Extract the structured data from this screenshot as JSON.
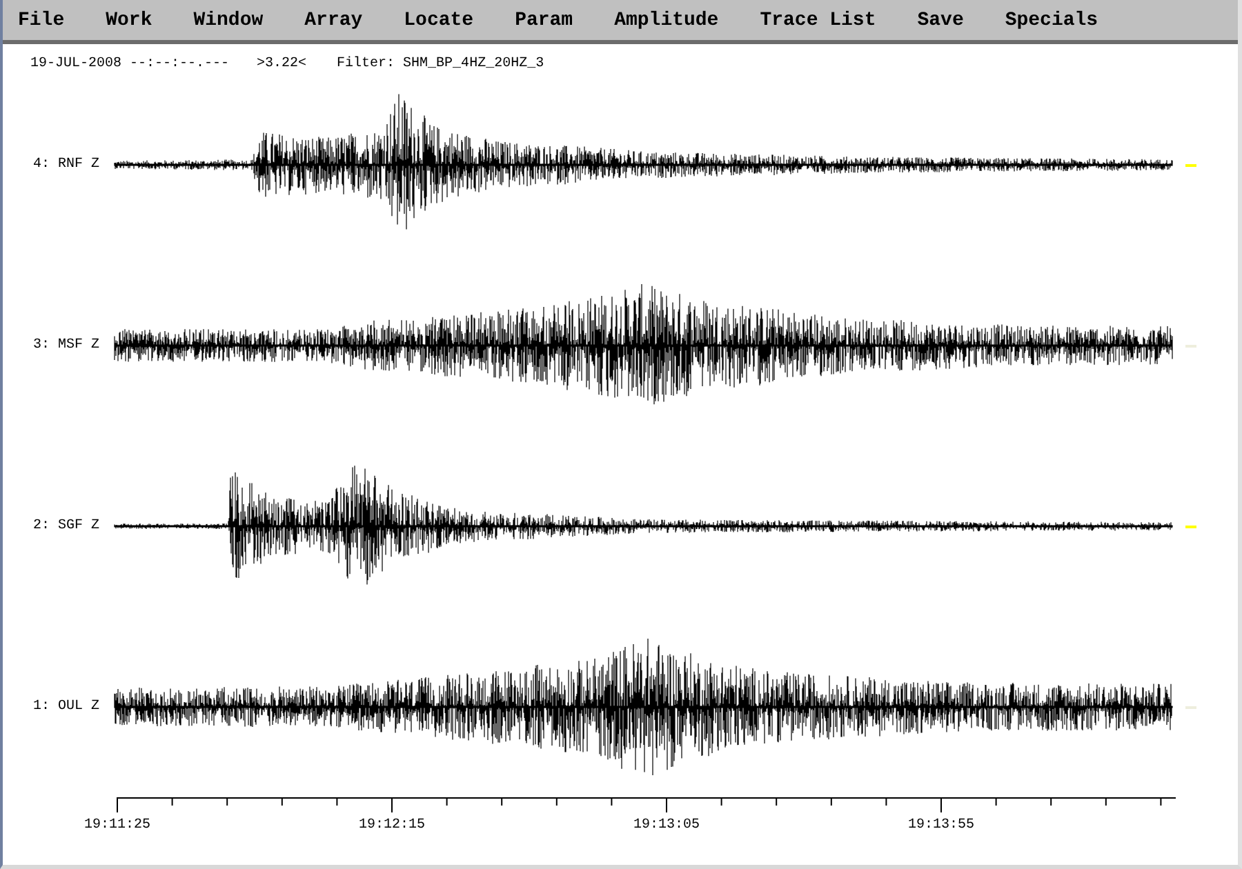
{
  "menu": [
    {
      "label": "File"
    },
    {
      "label": "Work"
    },
    {
      "label": "Window"
    },
    {
      "label": "Array"
    },
    {
      "label": "Locate"
    },
    {
      "label": "Param"
    },
    {
      "label": "Amplitude"
    },
    {
      "label": "Trace List"
    },
    {
      "label": "Save"
    },
    {
      "label": "Specials"
    }
  ],
  "header": {
    "date_time": "19-JUL-2008 --:--:--.---",
    "amplitude": ">3.22<",
    "filter": "Filter: SHM_BP_4HZ_20HZ_3"
  },
  "traces": [
    {
      "label": "4: RNF Z",
      "color": "#ffff00"
    },
    {
      "label": "3: MSF Z",
      "color": "#eeeedd"
    },
    {
      "label": "2: SGF Z",
      "color": "#ffff00"
    },
    {
      "label": "1: OUL Z",
      "color": "#eeeedd"
    }
  ],
  "time_axis": {
    "labels": [
      "19:11:25",
      "19:12:15",
      "19:13:05",
      "19:13:55"
    ]
  }
}
